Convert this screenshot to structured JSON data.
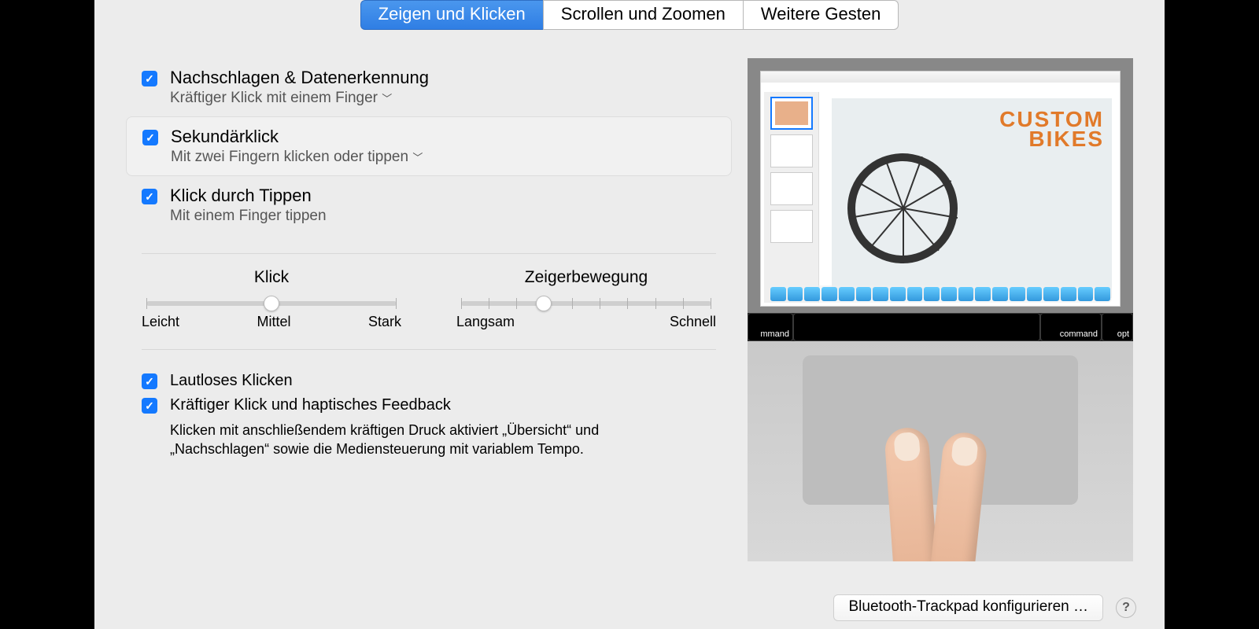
{
  "tabs": {
    "point": "Zeigen und Klicken",
    "scroll": "Scrollen und Zoomen",
    "more": "Weitere Gesten"
  },
  "options": {
    "lookup": {
      "title": "Nachschlagen & Datenerkennung",
      "sub": "Kräftiger Klick mit einem Finger"
    },
    "second": {
      "title": "Sekundärklick",
      "sub": "Mit zwei Fingern klicken oder tippen"
    },
    "tap": {
      "title": "Klick durch Tippen",
      "sub": "Mit einem Finger tippen"
    }
  },
  "sliders": {
    "click": {
      "title": "Klick",
      "min": "Leicht",
      "mid": "Mittel",
      "max": "Stark"
    },
    "pointer": {
      "title": "Zeigerbewegung",
      "min": "Langsam",
      "max": "Schnell"
    }
  },
  "extras": {
    "silent": "Lautloses Klicken",
    "force": "Kräftiger Klick und haptisches Feedback",
    "force_desc": "Klicken mit anschließendem kräftigen Druck aktiviert „Übersicht“ und „Nachschlagen“ sowie die Mediensteuerung mit variablem Tempo."
  },
  "preview": {
    "doc_title_1": "CUSTOM",
    "doc_title_2": "BIKES",
    "key_command": "command",
    "key_opt": "opt",
    "key_mmand": "mmand"
  },
  "footer": {
    "config": "Bluetooth-Trackpad konfigurieren …",
    "help": "?"
  }
}
